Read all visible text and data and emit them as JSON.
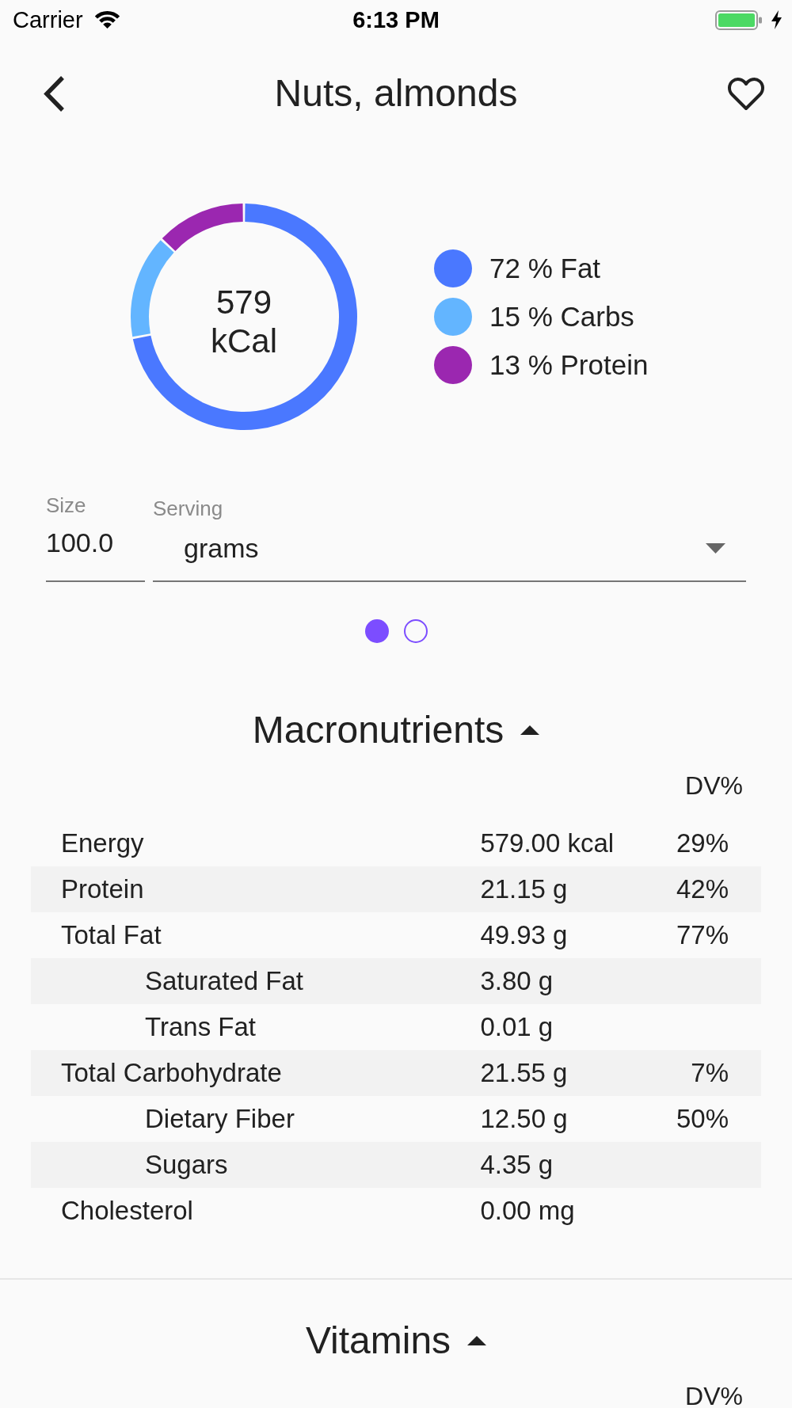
{
  "status_bar": {
    "carrier": "Carrier",
    "time": "6:13 PM"
  },
  "header": {
    "title": "Nuts, almonds",
    "favorited": false
  },
  "summary": {
    "energy_value": "579",
    "energy_unit": "kCal",
    "chart_data": {
      "type": "donut",
      "values": [
        72,
        15,
        13
      ]
    },
    "legend": [
      {
        "label": "72 % Fat",
        "color": "#4a78ff"
      },
      {
        "label": "15 % Carbs",
        "color": "#63b5ff"
      },
      {
        "label": "13 % Protein",
        "color": "#9b27b0"
      }
    ]
  },
  "serving": {
    "size": {
      "label": "Size",
      "value": "100.0"
    },
    "unit": {
      "label": "Serving",
      "value": "grams"
    }
  },
  "pages": [
    {
      "selected": true
    },
    {
      "selected": false
    }
  ],
  "sections": [
    {
      "title": "Macronutrients",
      "expanded": true,
      "dv_header": "DV%",
      "rows": [
        {
          "name": "Energy",
          "amount": "579.00 kcal",
          "dv": "29%"
        },
        {
          "name": "Protein",
          "amount": "21.15 g",
          "dv": "42%"
        },
        {
          "name": "Total Fat",
          "amount": "49.93 g",
          "dv": "77%",
          "children": [
            {
              "name": "Saturated Fat",
              "amount": "3.80 g"
            },
            {
              "name": "Trans Fat",
              "amount": "0.01 g"
            }
          ]
        },
        {
          "name": "Total Carbohydrate",
          "amount": "21.55 g",
          "dv": "7%",
          "children": [
            {
              "name": "Dietary Fiber",
              "amount": "12.50 g",
              "dv": "50%"
            },
            {
              "name": "Sugars",
              "amount": "4.35 g"
            }
          ]
        },
        {
          "name": "Cholesterol",
          "amount": "0.00 mg"
        }
      ]
    },
    {
      "title": "Vitamins",
      "expanded": true,
      "dv_header": "DV%"
    }
  ]
}
